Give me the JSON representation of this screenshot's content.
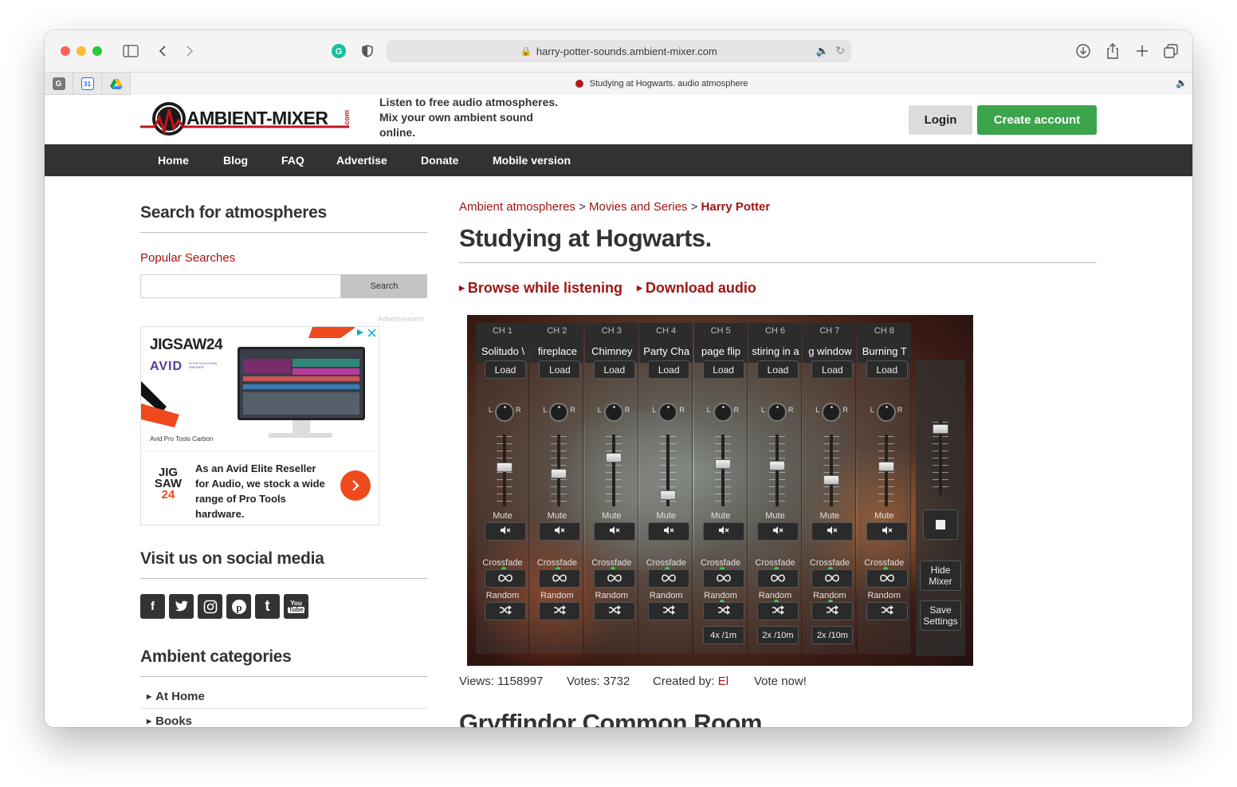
{
  "browser": {
    "url": "harry-potter-sounds.ambient-mixer.com",
    "tab_title": "Studying at Hogwarts. audio atmosphere",
    "pinned_tabs": [
      {
        "label": "G",
        "color": "#6e6e6e"
      },
      {
        "label": "31",
        "color": "#1a73e8"
      },
      {
        "label": "",
        "color": "#0f9d58"
      }
    ]
  },
  "header": {
    "logo_text": "AMBIENT-MIXER",
    "logo_suffix": ".com",
    "tagline": "Listen to free audio atmospheres. Mix your own ambient sound online.",
    "login_label": "Login",
    "create_label": "Create account"
  },
  "nav": {
    "items": [
      "Home",
      "Blog",
      "FAQ",
      "Advertise",
      "Donate",
      "Mobile version"
    ]
  },
  "sidebar": {
    "search_heading": "Search for atmospheres",
    "popular_label": "Popular Searches",
    "search_input_value": "",
    "search_button": "Search",
    "ad_label": "Advertisement",
    "ad": {
      "brand": "JIGSAW24",
      "partner": "AVID",
      "partner_sub": "ELITE SOLUTIONS PARTNER",
      "caption": "Avid Pro Tools Carbon",
      "logo_lines": [
        "JIG",
        "SAW",
        "24"
      ],
      "body": "As an Avid Elite Reseller for Audio, we stock a wide range of Pro Tools hardware."
    },
    "social_heading": "Visit us on social media",
    "social_icons": [
      "f",
      "t",
      "ig",
      "p",
      "t",
      "yt"
    ],
    "categories_heading": "Ambient categories",
    "categories": [
      "At Home",
      "Books"
    ]
  },
  "main": {
    "breadcrumb": [
      "Ambient atmospheres",
      "Movies and Series",
      "Harry Potter"
    ],
    "breadcrumb_sep": ">",
    "title": "Studying at Hogwarts.",
    "actions": [
      "Browse while listening",
      "Download audio"
    ],
    "mixer": {
      "channels": [
        {
          "label": "CH 1",
          "name": "Solitudo \\",
          "load": "Load",
          "volume": 0.55,
          "random_setting": ""
        },
        {
          "label": "CH 2",
          "name": "fireplace",
          "load": "Load",
          "volume": 0.45,
          "random_setting": ""
        },
        {
          "label": "CH 3",
          "name": "Chimney",
          "load": "Load",
          "volume": 0.7,
          "random_setting": ""
        },
        {
          "label": "CH 4",
          "name": "Party Cha",
          "load": "Load",
          "volume": 0.1,
          "random_setting": ""
        },
        {
          "label": "CH 5",
          "name": "page flip",
          "load": "Load",
          "volume": 0.6,
          "random_setting": "4x /1m"
        },
        {
          "label": "CH 6",
          "name": "stiring in a",
          "load": "Load",
          "volume": 0.58,
          "random_setting": "2x /10m"
        },
        {
          "label": "CH 7",
          "name": "g window",
          "load": "Load",
          "volume": 0.35,
          "random_setting": "2x /10m"
        },
        {
          "label": "CH 8",
          "name": "Burning T",
          "load": "Load",
          "volume": 0.57,
          "random_setting": ""
        }
      ],
      "pan_left": "L",
      "pan_right": "R",
      "mute_label": "Mute",
      "crossfade_label": "Crossfade",
      "random_label": "Random",
      "master_volume": 0.95,
      "hide_label": "Hide Mixer",
      "save_label": "Save Settings"
    },
    "stats": {
      "views": "Views: 1158997",
      "votes": "Votes: 3732",
      "created_prefix": "Created by:",
      "created_by": "El",
      "vote_now": "Vote now!"
    },
    "next_title": "Gryffindor Common Room"
  }
}
